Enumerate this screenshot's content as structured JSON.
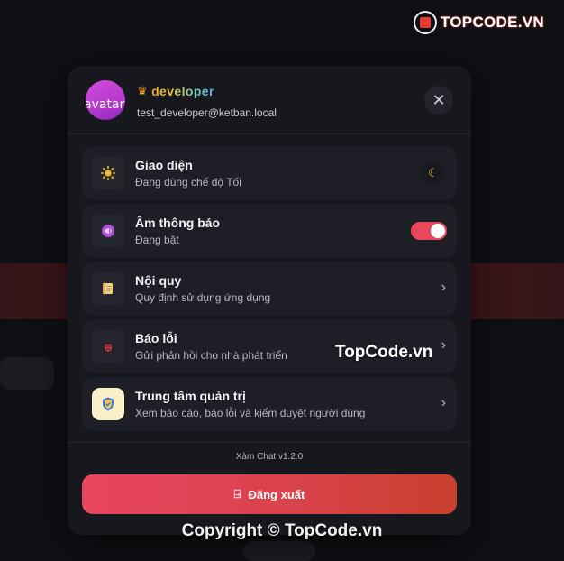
{
  "watermark": {
    "logo_text": "TOPCODE.VN",
    "center_text": "TopCode.vn",
    "footer_text": "Copyright © TopCode.vn"
  },
  "user": {
    "avatar_alt": "avatar",
    "role": "developer",
    "email": "test_developer@ketban.local"
  },
  "menu": {
    "items": [
      {
        "title": "Giao diện",
        "subtitle": "Đang dùng chế độ Tối",
        "icon": "sun-icon",
        "action": "moon-icon"
      },
      {
        "title": "Âm thông báo",
        "subtitle": "Đang bật",
        "icon": "speaker-icon",
        "toggle_on": true
      },
      {
        "title": "Nội quy",
        "subtitle": "Quy định sử dụng ứng dụng",
        "icon": "scroll-icon"
      },
      {
        "title": "Báo lỗi",
        "subtitle": "Gửi phản hồi cho nhà phát triển",
        "icon": "bug-icon"
      },
      {
        "title": "Trung tâm quản trị",
        "subtitle": "Xem báo cáo, báo lỗi và kiểm duyệt người dùng",
        "icon": "shield-icon"
      }
    ]
  },
  "footer": {
    "version": "Xàm Chat v1.2.0",
    "logout_label": "Đăng xuất"
  },
  "colors": {
    "accent": "#e8475c",
    "panel": "#17181e",
    "card": "#1e1f26"
  }
}
